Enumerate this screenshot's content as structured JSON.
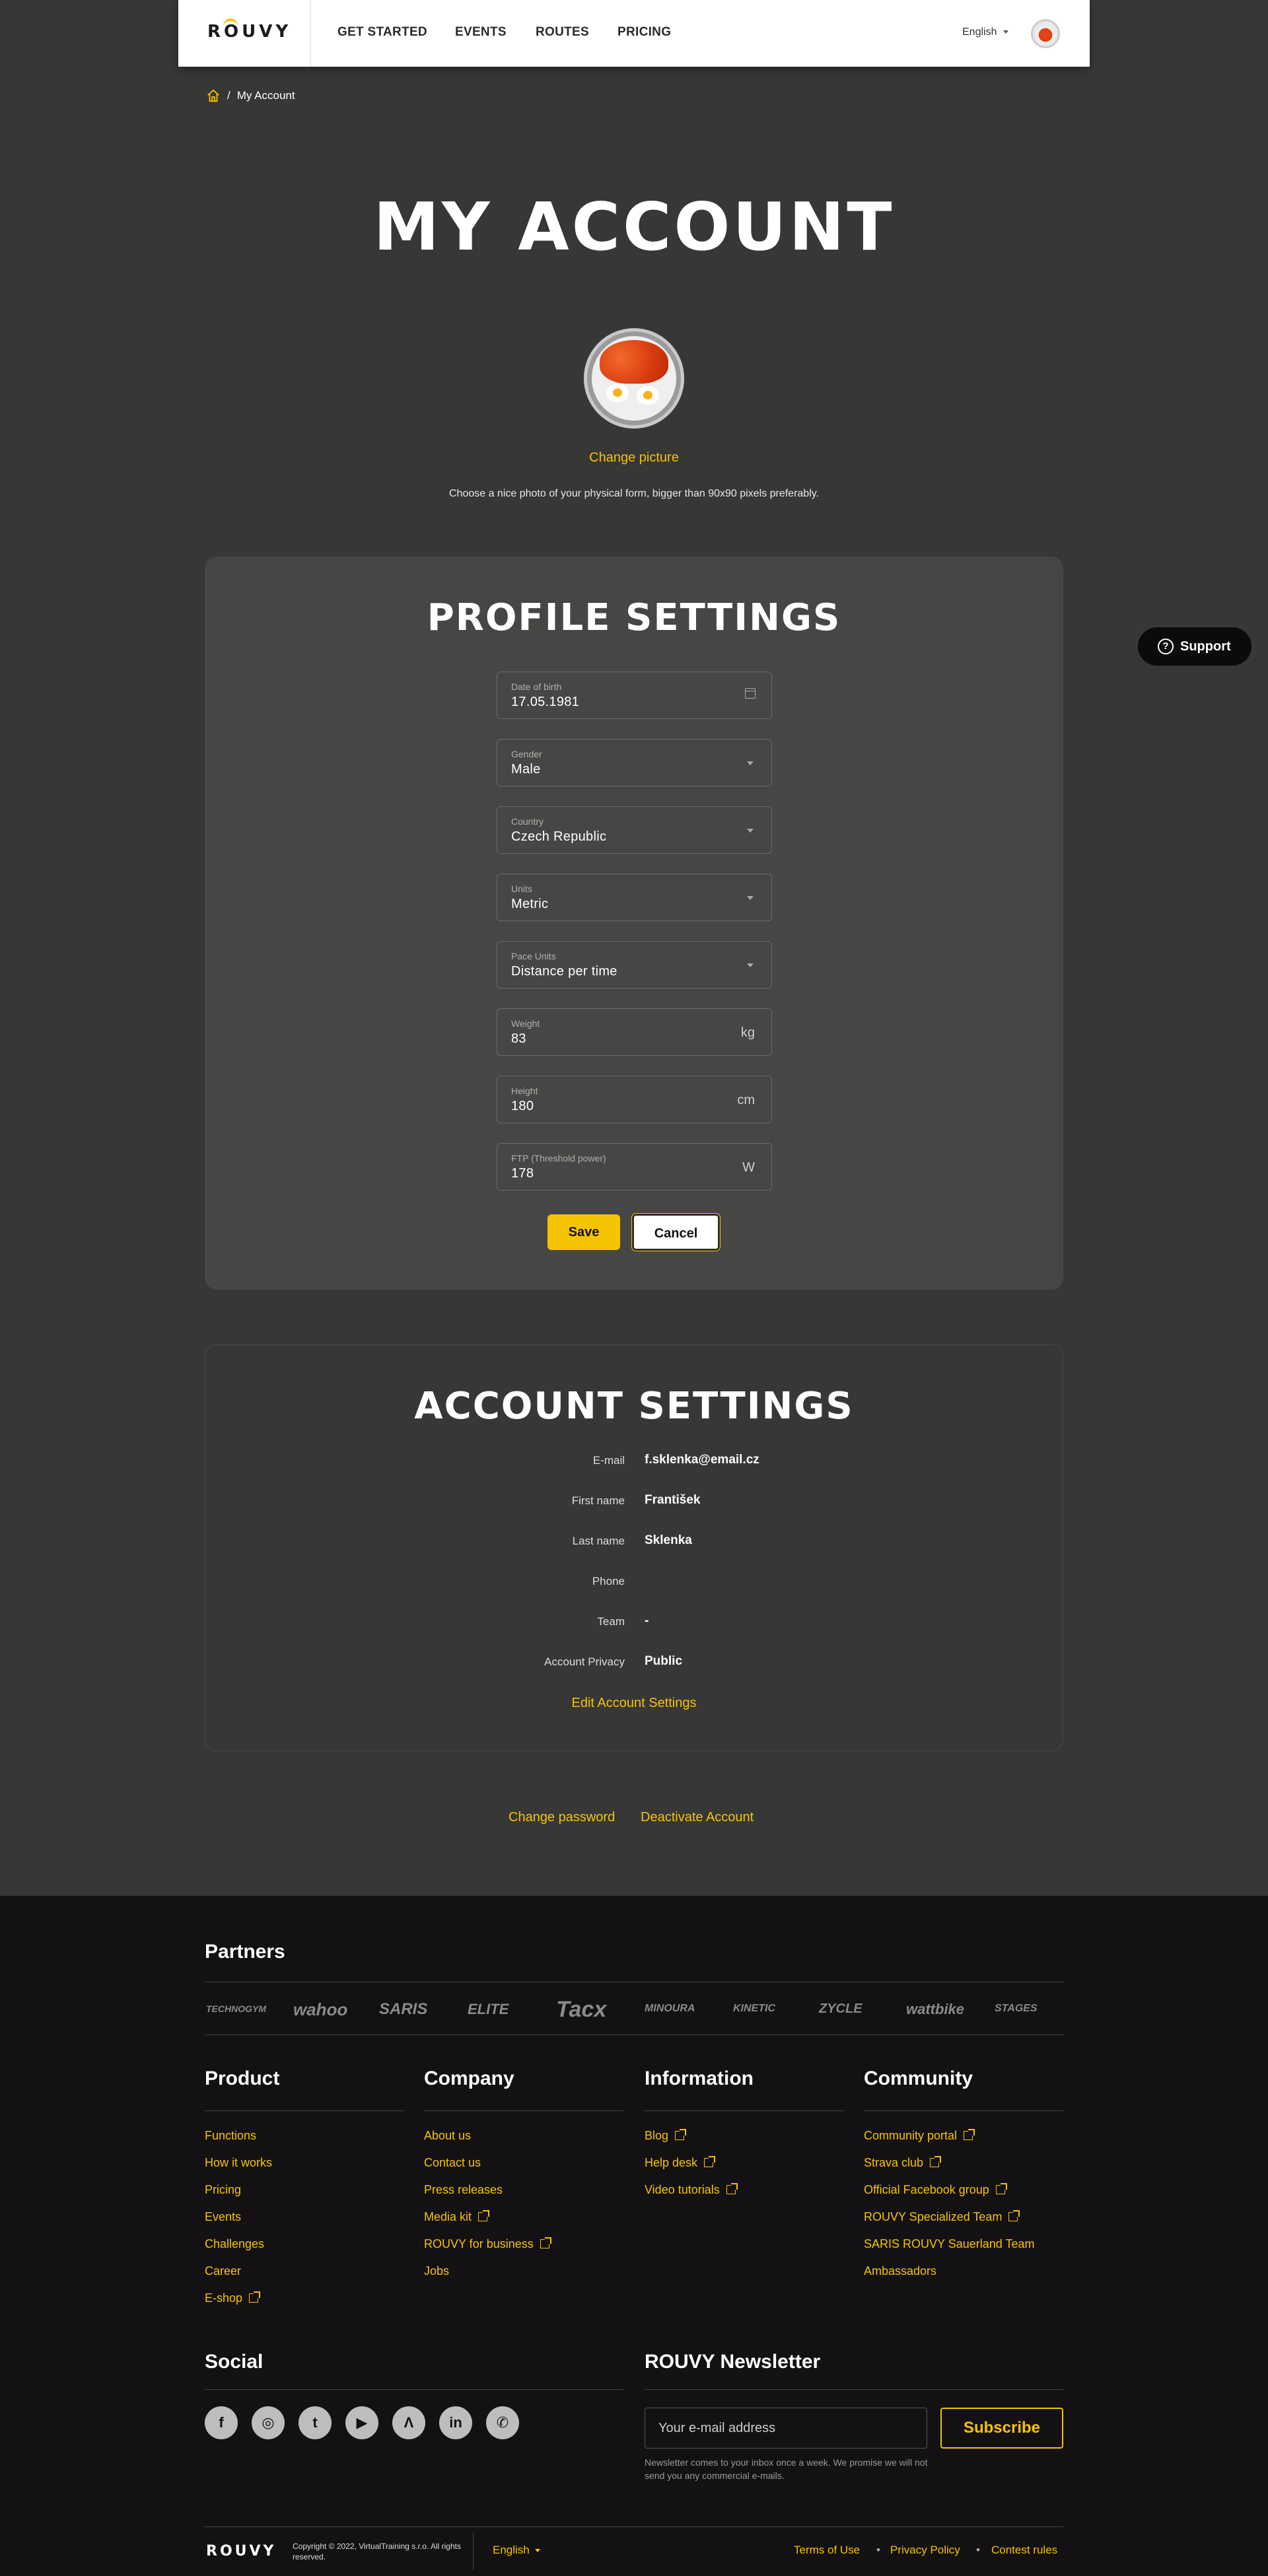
{
  "header": {
    "logo": "ROUVY",
    "nav": [
      "GET STARTED",
      "EVENTS",
      "ROUTES",
      "PRICING"
    ],
    "language": "English"
  },
  "breadcrumb": {
    "current": "My Account"
  },
  "page_title": "MY ACCOUNT",
  "profile_picture": {
    "change_label": "Change picture",
    "hint": "Choose a nice photo of your physical form, bigger than 90x90 pixels preferably."
  },
  "profile_settings": {
    "title": "PROFILE SETTINGS",
    "fields": [
      {
        "label": "Date of birth",
        "value": "17.05.1981",
        "icon": "calendar-icon"
      },
      {
        "label": "Gender",
        "value": "Male",
        "icon": "chevron-down-icon"
      },
      {
        "label": "Country",
        "value": "Czech Republic",
        "icon": "chevron-down-icon"
      },
      {
        "label": "Units",
        "value": "Metric",
        "icon": "chevron-down-icon"
      },
      {
        "label": "Pace Units",
        "value": "Distance per time",
        "icon": "chevron-down-icon"
      },
      {
        "label": "Weight",
        "value": "83",
        "unit": "kg"
      },
      {
        "label": "Height",
        "value": "180",
        "unit": "cm"
      },
      {
        "label": "FTP (Threshold power)",
        "value": "178",
        "unit": "W"
      }
    ],
    "save_label": "Save",
    "cancel_label": "Cancel"
  },
  "account_settings": {
    "title": "ACCOUNT SETTINGS",
    "rows": [
      {
        "label": "E-mail",
        "value": "f.sklenka@email.cz"
      },
      {
        "label": "First name",
        "value": "František"
      },
      {
        "label": "Last name",
        "value": "Sklenka"
      },
      {
        "label": "Phone",
        "value": ""
      },
      {
        "label": "Team",
        "value": "-"
      },
      {
        "label": "Account Privacy",
        "value": "Public"
      }
    ],
    "edit_label": "Edit Account Settings"
  },
  "account_links": {
    "change_password": "Change password",
    "deactivate": "Deactivate Account"
  },
  "support_label": "Support",
  "footer": {
    "partners_title": "Partners",
    "partners": [
      "TECHNOGYM",
      "wahoo",
      "SARIS",
      "ELITE",
      "Tacx",
      "MINOURA",
      "KINETIC",
      "ZYCLE",
      "wattbike",
      "STAGES"
    ],
    "columns": [
      {
        "title": "Product",
        "links": [
          {
            "label": "Functions",
            "external": false
          },
          {
            "label": "How it works",
            "external": false
          },
          {
            "label": "Pricing",
            "external": false
          },
          {
            "label": "Events",
            "external": false
          },
          {
            "label": "Challenges",
            "external": false
          },
          {
            "label": "Career",
            "external": false
          },
          {
            "label": "E-shop",
            "external": true
          }
        ]
      },
      {
        "title": "Company",
        "links": [
          {
            "label": "About us",
            "external": false
          },
          {
            "label": "Contact us",
            "external": false
          },
          {
            "label": "Press releases",
            "external": false
          },
          {
            "label": "Media kit",
            "external": true
          },
          {
            "label": "ROUVY for business",
            "external": true
          },
          {
            "label": "Jobs",
            "external": false
          }
        ]
      },
      {
        "title": "Information",
        "links": [
          {
            "label": "Blog",
            "external": true
          },
          {
            "label": "Help desk",
            "external": true
          },
          {
            "label": "Video tutorials",
            "external": true
          }
        ]
      },
      {
        "title": "Community",
        "links": [
          {
            "label": "Community portal",
            "external": true
          },
          {
            "label": "Strava club",
            "external": true
          },
          {
            "label": "Official Facebook group",
            "external": true
          },
          {
            "label": "ROUVY Specialized Team",
            "external": true
          },
          {
            "label": "SARIS ROUVY Sauerland Team",
            "external": false
          },
          {
            "label": "Ambassadors",
            "external": false
          }
        ]
      }
    ],
    "social_title": "Social",
    "social": [
      "facebook-icon",
      "instagram-icon",
      "twitter-icon",
      "youtube-icon",
      "strava-icon",
      "linkedin-icon",
      "whatsapp-icon"
    ],
    "newsletter_title": "ROUVY Newsletter",
    "newsletter_placeholder": "Your e-mail address",
    "subscribe_label": "Subscribe",
    "newsletter_note": "Newsletter comes to your inbox once a week. We promise we will not send you any commercial e-mails.",
    "logo": "ROUVY",
    "copyright": "Copyright © 2022, VirtualTraining s.r.o. All rights reserved.",
    "language": "English",
    "legal": [
      "Terms of Use",
      "Privacy Policy",
      "Contest rules"
    ]
  },
  "colors": {
    "accent": "#f5c400",
    "background": "#373735",
    "card": "#464644",
    "footer": "#141114"
  }
}
